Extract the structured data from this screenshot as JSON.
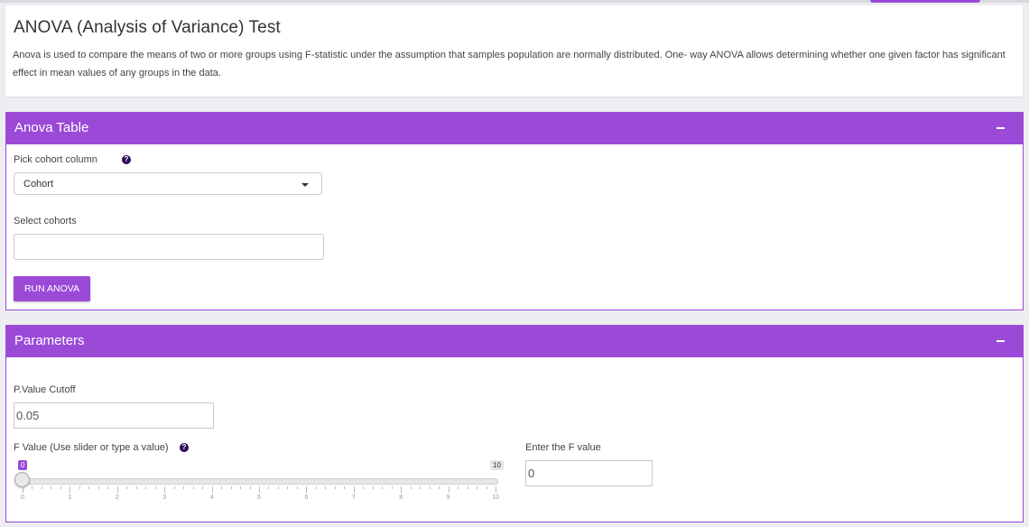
{
  "intro": {
    "title": "ANOVA (Analysis of Variance) Test",
    "description": "Anova is used to compare the means of two or more groups using F-statistic under the assumption that samples population are normally distributed. One- way ANOVA allows determining whether one given factor has significant effect in mean values of any groups in the data."
  },
  "anova_box": {
    "title": "Anova Table",
    "cohort_column_label": "Pick cohort column",
    "cohort_column_value": "Cohort",
    "select_cohorts_label": "Select cohorts",
    "select_cohorts_value": "",
    "run_button_label": "RUN ANOVA"
  },
  "params_box": {
    "title": "Parameters",
    "pvalue_label": "P.Value Cutoff",
    "pvalue_value": "0.05",
    "fvalue_slider_label": "F Value (Use slider or type a value)",
    "slider": {
      "min": 0,
      "max": 10,
      "value": 0,
      "min_badge": "0",
      "max_badge": "10",
      "tick_labels": [
        "0",
        "1",
        "2",
        "3",
        "4",
        "5",
        "6",
        "7",
        "8",
        "9",
        "10"
      ]
    },
    "fvalue_input_label": "Enter the F value",
    "fvalue_input_value": "0"
  },
  "colors": {
    "accent": "#9b4ad8",
    "help_icon": "#2a0a55",
    "background": "#eceef1"
  },
  "icons": {
    "help": "question-circle-icon",
    "collapse": "minus-icon",
    "dropdown": "caret-down-icon"
  }
}
